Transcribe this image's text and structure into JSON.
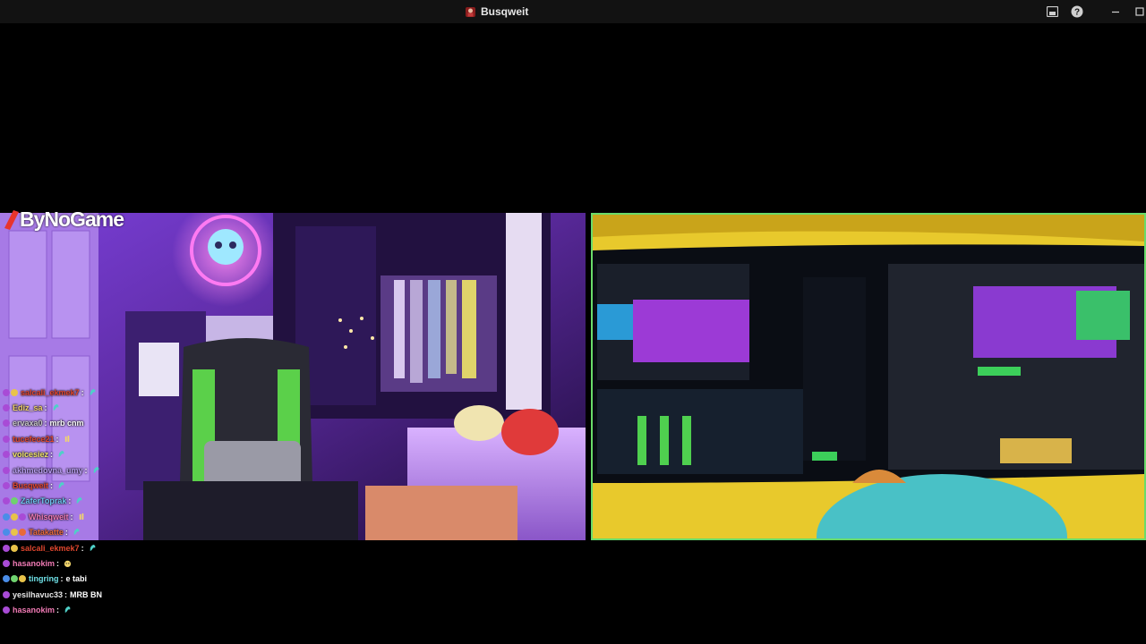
{
  "window": {
    "title": "Busqweit",
    "controls": [
      "picture-in-picture",
      "help",
      "minimize",
      "maximize"
    ]
  },
  "overlay": {
    "logo_text": "ByNoGame"
  },
  "chat": [
    {
      "user": "salcali_ekmek7",
      "color": "#e0462e",
      "badges": [
        "#a84bd6",
        "#e8c34a"
      ],
      "message": "",
      "emote": "shrimp-emote"
    },
    {
      "user": "Ediz_sa",
      "color": "#f2d36b",
      "badges": [
        "#a84bd6"
      ],
      "message": "",
      "emote": "shrimp-emote"
    },
    {
      "user": "ervaxa0",
      "color": "#c6c6c6",
      "badges": [
        "#a84bd6"
      ],
      "message": "mrb cnm",
      "emote": ""
    },
    {
      "user": "tucefece21",
      "color": "#e0462e",
      "badges": [
        "#a84bd6"
      ],
      "message": "",
      "emote": "hands-emote"
    },
    {
      "user": "voicesiez",
      "color": "#f2e66b",
      "badges": [
        "#a84bd6"
      ],
      "message": "",
      "emote": "shrimp-emote"
    },
    {
      "user": "akhmedovna_umy",
      "color": "#b79ef0",
      "badges": [
        "#a84bd6"
      ],
      "message": "",
      "emote": "shrimp-emote"
    },
    {
      "user": "Busqweit",
      "color": "#e0462e",
      "badges": [
        "#a84bd6"
      ],
      "message": "",
      "emote": "shrimp-emote"
    },
    {
      "user": "ZaferToprak",
      "color": "#6ec6f0",
      "badges": [
        "#a84bd6",
        "#6fd36f"
      ],
      "message": "",
      "emote": "shrimp-emote"
    },
    {
      "user": "Whisqweit",
      "color": "#f07ab4",
      "badges": [
        "#4a8de8",
        "#e8c34a",
        "#a84bd6"
      ],
      "message": "",
      "emote": "hands-emote"
    },
    {
      "user": "Tatakatte",
      "color": "#e86a3a",
      "badges": [
        "#4a8de8",
        "#e8c34a",
        "#e86a3a"
      ],
      "message": "",
      "emote": "shrimp-emote"
    },
    {
      "user": "salcali_ekmek7",
      "color": "#e0462e",
      "badges": [
        "#a84bd6",
        "#e8c34a"
      ],
      "message": "",
      "emote": "shrimp-emote"
    },
    {
      "user": "hasanokim",
      "color": "#f07ab4",
      "badges": [
        "#a84bd6"
      ],
      "message": "",
      "emote": "face-emote"
    },
    {
      "user": "tingring",
      "color": "#6fe0e6",
      "badges": [
        "#4a8de8",
        "#6fd36f",
        "#e8c34a"
      ],
      "message": "e tabi",
      "emote": ""
    },
    {
      "user": "yesilhavuc33",
      "color": "#e6e6e6",
      "badges": [
        "#a84bd6"
      ],
      "message": "MRB BN",
      "emote": ""
    },
    {
      "user": "hasanokim",
      "color": "#f07ab4",
      "badges": [
        "#a84bd6"
      ],
      "message": "",
      "emote": "shrimp-emote"
    }
  ]
}
